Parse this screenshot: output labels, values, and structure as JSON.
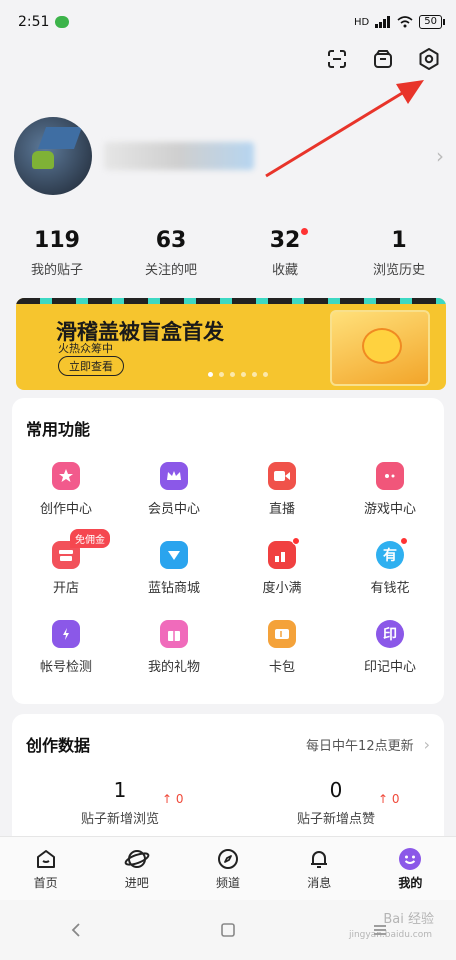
{
  "status": {
    "time": "2:51",
    "battery": "50",
    "hd": "HD"
  },
  "profile": {
    "arrow": "›"
  },
  "stats": [
    {
      "num": "119",
      "label": "我的贴子",
      "dot": false
    },
    {
      "num": "63",
      "label": "关注的吧",
      "dot": false
    },
    {
      "num": "32",
      "label": "收藏",
      "dot": true
    },
    {
      "num": "1",
      "label": "浏览历史",
      "dot": false
    }
  ],
  "banner": {
    "title": "滑稽盖被盲盒首发",
    "subtitle": "火热众筹中",
    "button": "立即查看",
    "accent": "#f6c52e"
  },
  "functions": {
    "title": "常用功能",
    "items": [
      {
        "label": "创作中心",
        "icon": "star-icon",
        "color": "#f25a8c"
      },
      {
        "label": "会员中心",
        "icon": "crown-icon",
        "color": "#8b58e8"
      },
      {
        "label": "直播",
        "icon": "video-camera-icon",
        "color": "#f0524a"
      },
      {
        "label": "游戏中心",
        "icon": "gamepad-icon",
        "color": "#f1567a"
      },
      {
        "label": "开店",
        "icon": "shop-icon",
        "color": "#f2515a",
        "badge": "免佣金"
      },
      {
        "label": "蓝钻商城",
        "icon": "diamond-icon",
        "color": "#2aa4ee"
      },
      {
        "label": "度小满",
        "icon": "chart-icon",
        "color": "#f04040",
        "dot": true
      },
      {
        "label": "有钱花",
        "icon": "money-icon",
        "color": "#2fb0f0",
        "glyph": "有",
        "dot": true
      },
      {
        "label": "帐号检测",
        "icon": "shield-icon",
        "color": "#8b58e8"
      },
      {
        "label": "我的礼物",
        "icon": "gift-icon",
        "color": "#f06bbb"
      },
      {
        "label": "卡包",
        "icon": "card-icon",
        "color": "#f4a23a"
      },
      {
        "label": "印记中心",
        "icon": "seal-icon",
        "color": "#8b58e8",
        "glyph": "印"
      }
    ]
  },
  "creation": {
    "title": "创作数据",
    "note": "每日中午12点更新",
    "arrow": "›",
    "metrics": [
      {
        "num": "1",
        "label": "贴子新增浏览",
        "delta": "↑ 0"
      },
      {
        "num": "0",
        "label": "贴子新增点赞",
        "delta": "↑ 0"
      }
    ]
  },
  "tabs": [
    {
      "label": "首页",
      "icon": "home-icon"
    },
    {
      "label": "进吧",
      "icon": "planet-icon"
    },
    {
      "label": "频道",
      "icon": "compass-icon"
    },
    {
      "label": "消息",
      "icon": "bell-icon"
    },
    {
      "label": "我的",
      "icon": "smile-icon",
      "active": true
    }
  ],
  "watermark": {
    "main": "Bai 经验",
    "sub": "jingyan.baidu.com"
  }
}
